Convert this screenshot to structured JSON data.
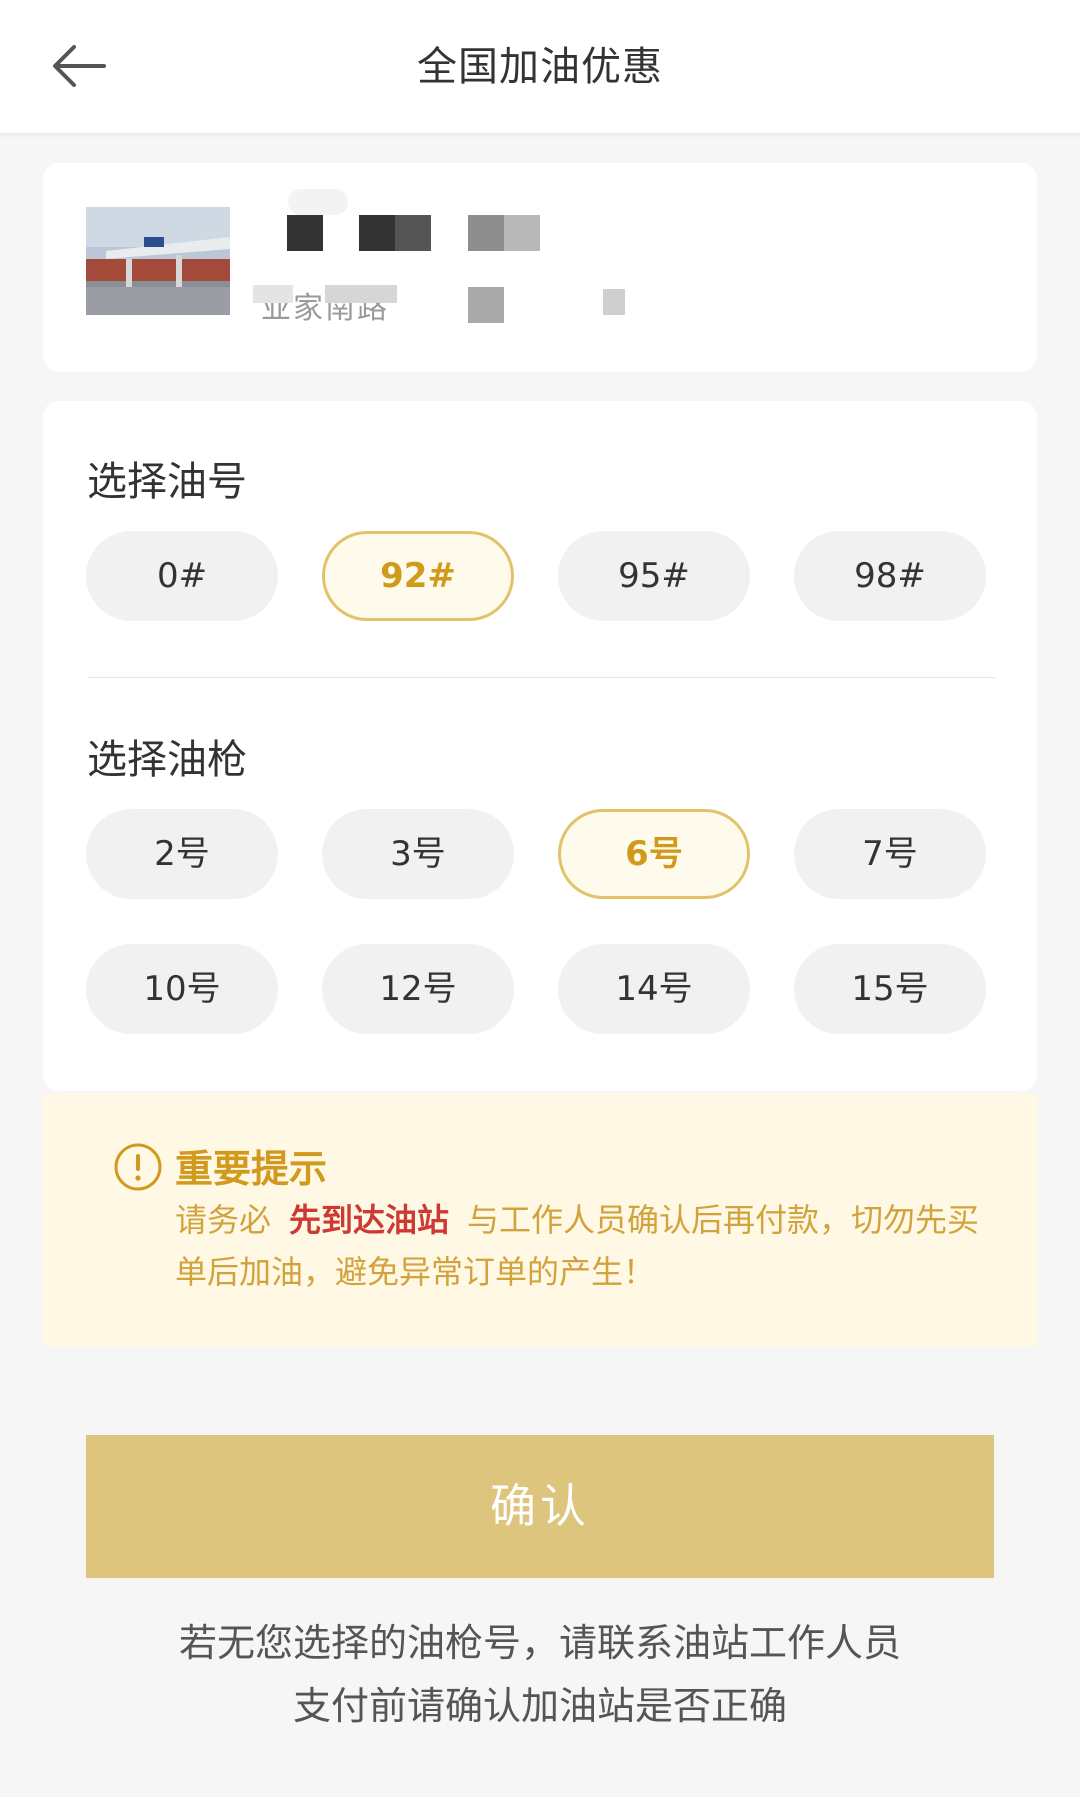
{
  "header": {
    "title": "全国加油优惠"
  },
  "station": {
    "address_fragment": "业家南路"
  },
  "fuel_section": {
    "title": "选择油号",
    "options": [
      "0#",
      "92#",
      "95#",
      "98#"
    ],
    "selected": "92#"
  },
  "nozzle_section": {
    "title": "选择油枪",
    "options": [
      "2号",
      "3号",
      "6号",
      "7号",
      "10号",
      "12号",
      "14号",
      "15号"
    ],
    "selected": "6号"
  },
  "notice": {
    "title": "重要提示",
    "text_before": "请务必",
    "highlight": "先到达油站",
    "text_after": "与工作人员确认后再付款，切勿先买单后加油，避免异常订单的产生！"
  },
  "confirm_label": "确认",
  "footer": {
    "line1": "若无您选择的油枪号，请联系油站工作人员",
    "line2": "支付前请确认加油站是否正确"
  },
  "colors": {
    "accent": "#ddc57d",
    "selected_text": "#d29a1c",
    "highlight": "#cc3a33"
  },
  "icons": [
    "back-arrow-icon",
    "alert-circle-icon"
  ]
}
